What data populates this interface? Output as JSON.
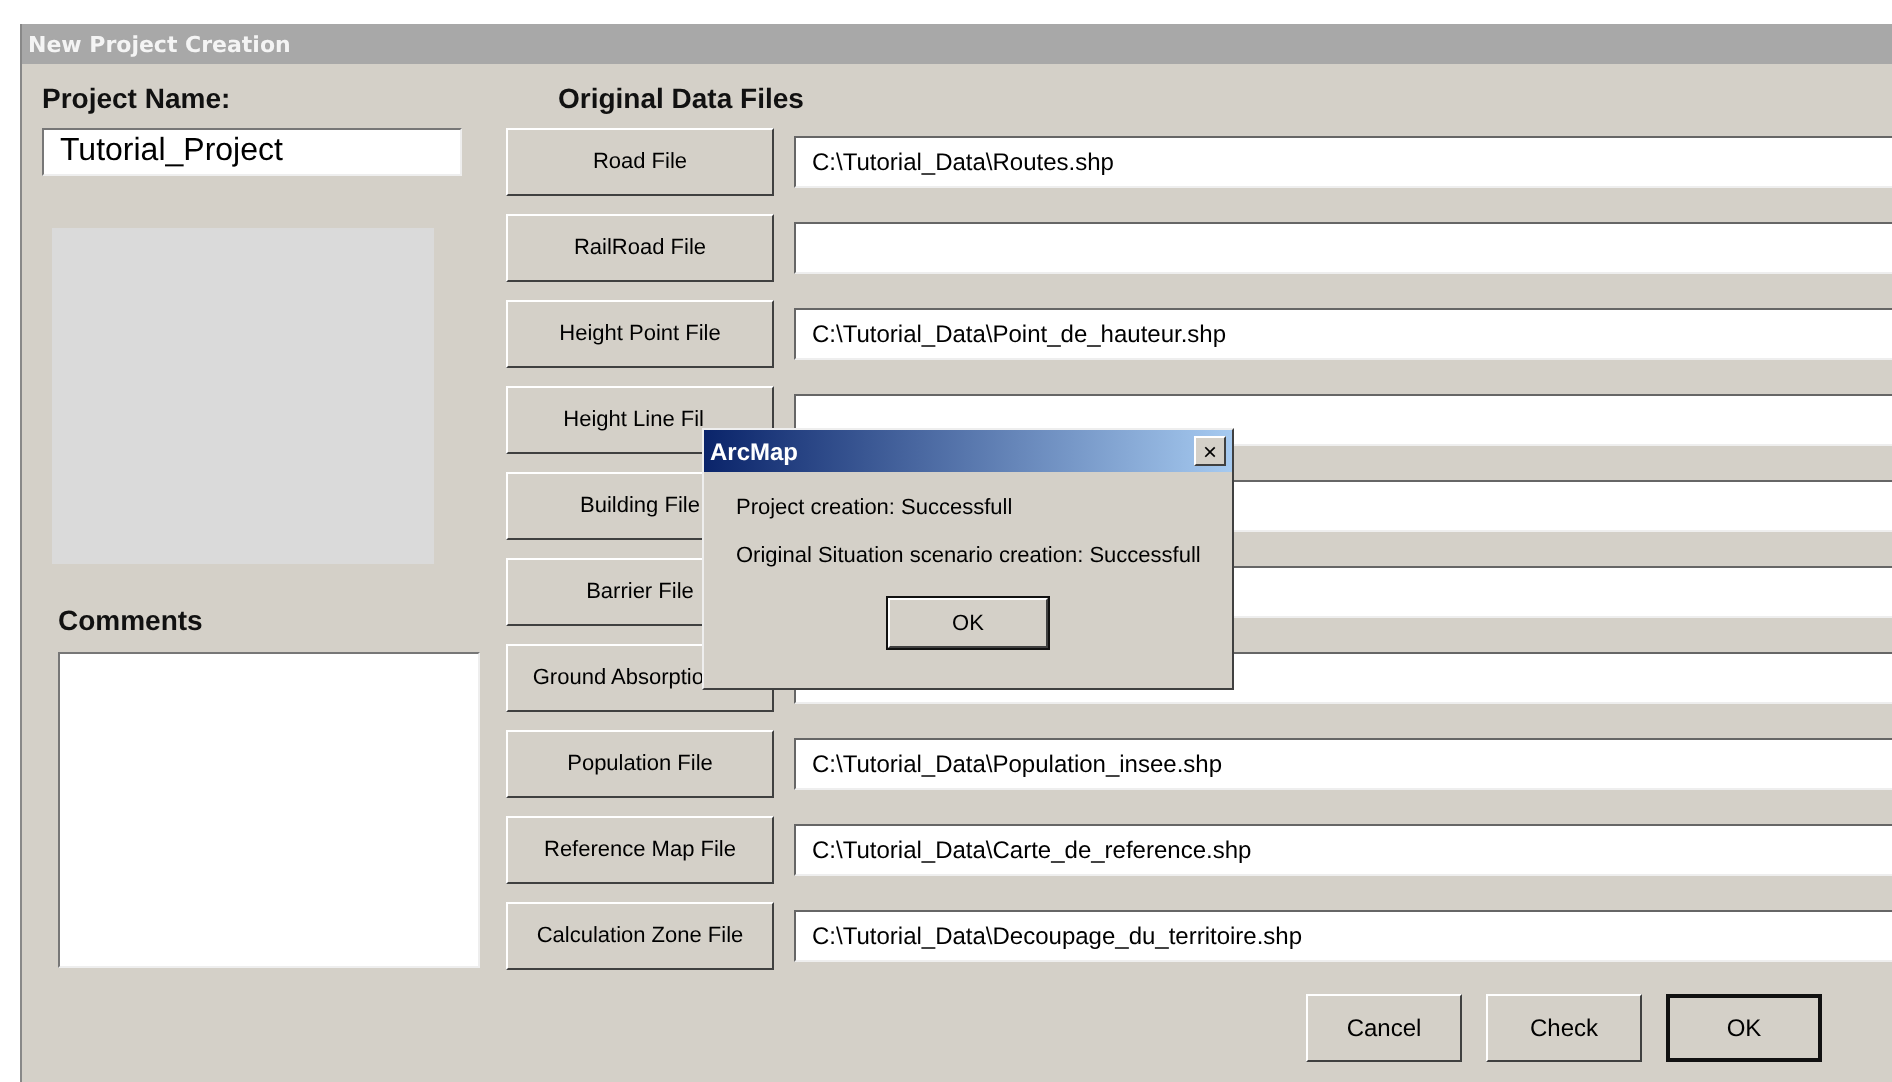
{
  "window": {
    "title": "New Project Creation"
  },
  "project_name": {
    "label": "Project Name:",
    "value": "Tutorial_Project"
  },
  "comments": {
    "label": "Comments"
  },
  "data_files": {
    "heading": "Original Data Files",
    "rows": [
      {
        "button": "Road File",
        "path": "C:\\Tutorial_Data\\Routes.shp"
      },
      {
        "button": "RailRoad File"
      },
      {
        "button": "Height Point File",
        "path": "C:\\Tutorial_Data\\Point_de_hauteur.shp"
      },
      {
        "button": "Height Line Fil",
        "kind": "partial"
      },
      {
        "button": "Building File"
      },
      {
        "button": "Barrier File"
      },
      {
        "button": "Ground Absorptio",
        "kind": "partial"
      },
      {
        "button": "Population File",
        "path": "C:\\Tutorial_Data\\Population_insee.shp"
      },
      {
        "button": "Reference Map File",
        "path": "C:\\Tutorial_Data\\Carte_de_reference.shp"
      },
      {
        "button": "Calculation Zone File",
        "path": "C:\\Tutorial_Data\\Decoupage_du_territoire.shp"
      }
    ]
  },
  "buttons": [
    {
      "label": "Cancel",
      "default": false
    },
    {
      "label": "Check",
      "default": false
    },
    {
      "label": "OK",
      "default": true
    }
  ],
  "message_box": {
    "title": "ArcMap",
    "close": "×",
    "lines": [
      "Project creation: Successfull",
      "Original Situation scenario creation: Successfull"
    ],
    "button": "OK"
  }
}
